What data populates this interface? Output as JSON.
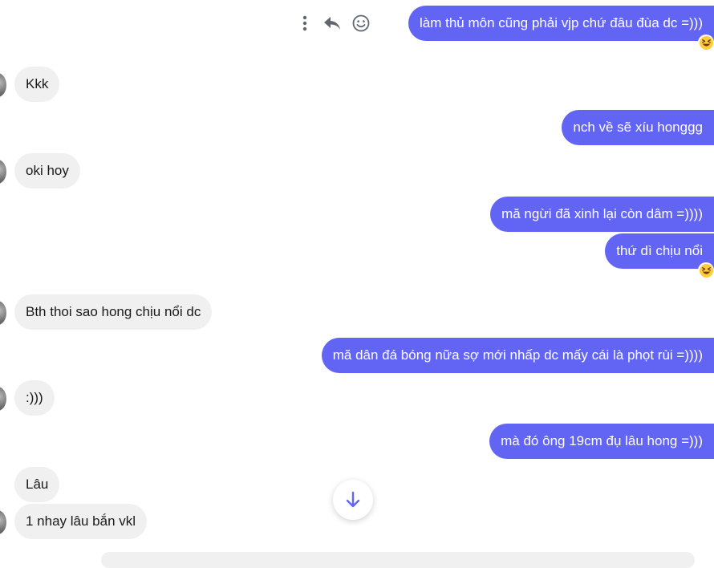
{
  "messages": [
    {
      "side": "out",
      "text": "làm thủ môn cũng phải vjp chứ đâu đùa dc =)))",
      "reaction": "laugh"
    },
    {
      "side": "in",
      "text": "Kkk"
    },
    {
      "side": "out",
      "text": "nch về sẽ xíu honggg"
    },
    {
      "side": "in",
      "text": "oki hoy"
    },
    {
      "side": "out",
      "text": "mă ngừi đã xinh lại còn dâm =))))"
    },
    {
      "side": "out",
      "text": "thứ dì chịu nổi",
      "reaction": "laugh"
    },
    {
      "side": "in",
      "text": "Bth thoi sao hong chịu nổi dc"
    },
    {
      "side": "out",
      "text": "mă dân đá bóng nữa sợ mới nhấp dc mấy cái là phọt rùi =))))"
    },
    {
      "side": "in",
      "text": ":)))"
    },
    {
      "side": "out",
      "text": "mà đó ông 19cm đụ lâu hong =)))"
    },
    {
      "side": "in",
      "text": "Lâu"
    },
    {
      "side": "in",
      "text": "1 nhay lâu bắn vkl"
    }
  ],
  "message_actions": [
    "more-options-icon",
    "reply-icon",
    "emoji-icon"
  ],
  "reaction_emoji": "😆",
  "colors": {
    "outgoing_bubble": "#6264f4",
    "incoming_bubble": "#f0f0f0",
    "accent": "#6264f4"
  },
  "scroll_button_icon": "arrow-down-icon"
}
